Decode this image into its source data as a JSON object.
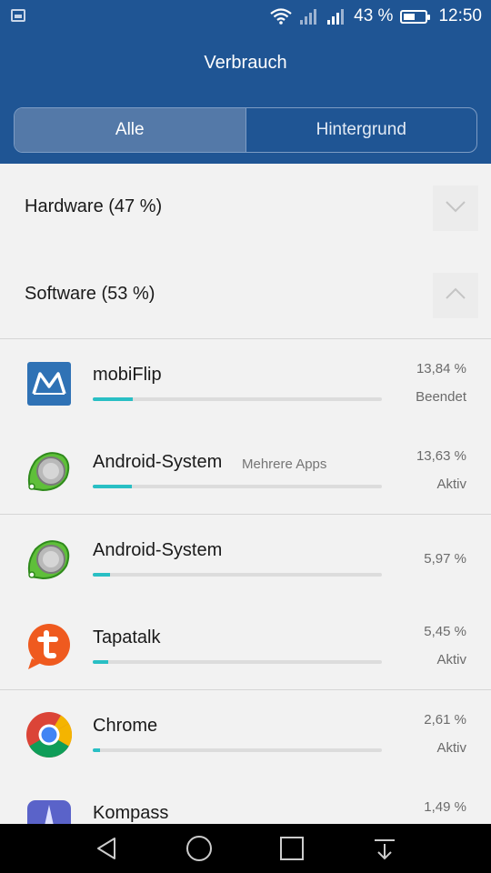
{
  "status_bar": {
    "battery_percent": "43 %",
    "time": "12:50",
    "icons": [
      "notification-icon",
      "wifi-icon",
      "signal-icon",
      "signal-icon",
      "battery-icon"
    ]
  },
  "header": {
    "title": "Verbrauch",
    "tabs": [
      {
        "label": "Alle",
        "selected": true
      },
      {
        "label": "Hintergrund",
        "selected": false
      }
    ]
  },
  "sections": {
    "hardware": {
      "label": "Hardware (47 %)",
      "expanded": false
    },
    "software": {
      "label": "Software (53 %)",
      "expanded": true
    }
  },
  "apps": [
    {
      "name": "mobiFlip",
      "extra": "",
      "percent": "13,84 %",
      "state": "Beendet",
      "icon": "mobiflip-icon",
      "level": 0.1384
    },
    {
      "name": "Android-System",
      "extra": "Mehrere Apps",
      "percent": "13,63 %",
      "state": "Aktiv",
      "icon": "android-system-icon",
      "level": 0.1363
    },
    {
      "name": "Android-System",
      "extra": "",
      "percent": "5,97 %",
      "state": "",
      "icon": "android-system-icon",
      "level": 0.0597
    },
    {
      "name": "Tapatalk",
      "extra": "",
      "percent": "5,45 %",
      "state": "Aktiv",
      "icon": "tapatalk-icon",
      "level": 0.0545
    },
    {
      "name": "Chrome",
      "extra": "",
      "percent": "2,61 %",
      "state": "Aktiv",
      "icon": "chrome-icon",
      "level": 0.0261
    },
    {
      "name": "Kompass",
      "extra": "",
      "percent": "1,49 %",
      "state": "",
      "icon": "compass-icon",
      "level": 0.0149
    }
  ],
  "colors": {
    "header": "#1f5594",
    "progress": "#29bfc4"
  },
  "nav_bar": [
    "back-icon",
    "home-icon",
    "recents-icon",
    "notification-pulldown-icon"
  ]
}
